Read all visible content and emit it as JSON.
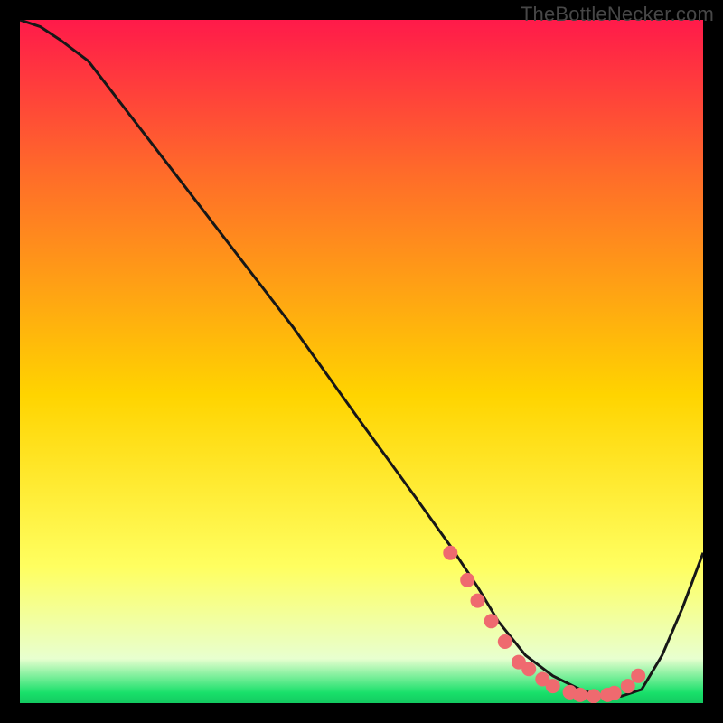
{
  "attribution": "TheBottleNecker.com",
  "colors": {
    "top": "#ff1a4a",
    "mid1": "#ff6a2a",
    "mid2": "#ffd400",
    "mid3": "#ffff60",
    "pale": "#e8ffcf",
    "green": "#18e06a",
    "line": "#171717",
    "marker": "#ef6a6f",
    "bg": "#000000"
  },
  "chart_data": {
    "type": "line",
    "title": "",
    "xlabel": "",
    "ylabel": "",
    "xlim": [
      0,
      100
    ],
    "ylim": [
      0,
      100
    ],
    "series": [
      {
        "name": "curve",
        "x": [
          0,
          3,
          6,
          10,
          20,
          30,
          40,
          50,
          58,
          63,
          67,
          70,
          74,
          78,
          82,
          85,
          88,
          91,
          94,
          97,
          100
        ],
        "y": [
          100,
          99,
          97,
          94,
          81,
          68,
          55,
          41,
          30,
          23,
          17,
          12,
          7,
          4,
          2,
          1,
          1,
          2,
          7,
          14,
          22
        ]
      }
    ],
    "markers": {
      "name": "highlight-points",
      "x": [
        63,
        65.5,
        67,
        69,
        71,
        73,
        74.5,
        76.5,
        78,
        80.5,
        82,
        84,
        86,
        87,
        89,
        90.5
      ],
      "y": [
        22,
        18,
        15,
        12,
        9,
        6,
        5,
        3.5,
        2.5,
        1.6,
        1.2,
        1.0,
        1.2,
        1.5,
        2.5,
        4
      ]
    }
  }
}
